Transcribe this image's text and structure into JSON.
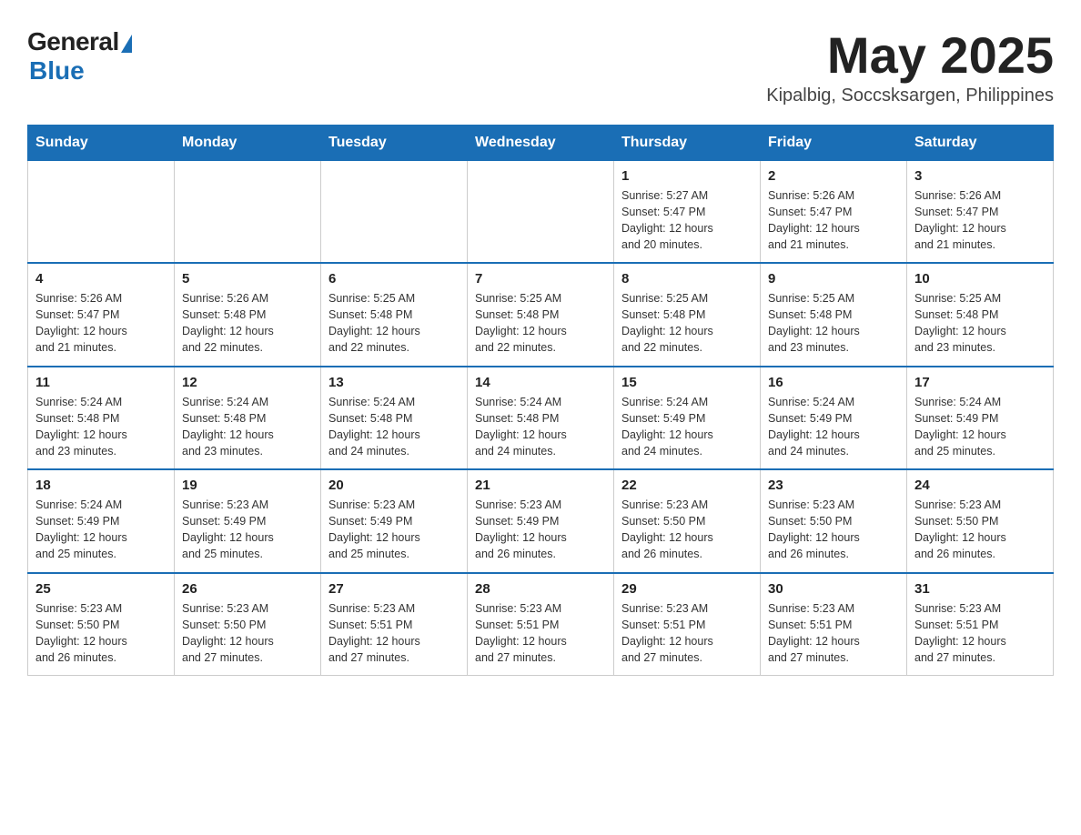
{
  "header": {
    "logo_general": "General",
    "logo_blue": "Blue",
    "month_title": "May 2025",
    "location": "Kipalbig, Soccsksargen, Philippines"
  },
  "weekdays": [
    "Sunday",
    "Monday",
    "Tuesday",
    "Wednesday",
    "Thursday",
    "Friday",
    "Saturday"
  ],
  "weeks": [
    [
      {
        "day": "",
        "info": ""
      },
      {
        "day": "",
        "info": ""
      },
      {
        "day": "",
        "info": ""
      },
      {
        "day": "",
        "info": ""
      },
      {
        "day": "1",
        "info": "Sunrise: 5:27 AM\nSunset: 5:47 PM\nDaylight: 12 hours\nand 20 minutes."
      },
      {
        "day": "2",
        "info": "Sunrise: 5:26 AM\nSunset: 5:47 PM\nDaylight: 12 hours\nand 21 minutes."
      },
      {
        "day": "3",
        "info": "Sunrise: 5:26 AM\nSunset: 5:47 PM\nDaylight: 12 hours\nand 21 minutes."
      }
    ],
    [
      {
        "day": "4",
        "info": "Sunrise: 5:26 AM\nSunset: 5:47 PM\nDaylight: 12 hours\nand 21 minutes."
      },
      {
        "day": "5",
        "info": "Sunrise: 5:26 AM\nSunset: 5:48 PM\nDaylight: 12 hours\nand 22 minutes."
      },
      {
        "day": "6",
        "info": "Sunrise: 5:25 AM\nSunset: 5:48 PM\nDaylight: 12 hours\nand 22 minutes."
      },
      {
        "day": "7",
        "info": "Sunrise: 5:25 AM\nSunset: 5:48 PM\nDaylight: 12 hours\nand 22 minutes."
      },
      {
        "day": "8",
        "info": "Sunrise: 5:25 AM\nSunset: 5:48 PM\nDaylight: 12 hours\nand 22 minutes."
      },
      {
        "day": "9",
        "info": "Sunrise: 5:25 AM\nSunset: 5:48 PM\nDaylight: 12 hours\nand 23 minutes."
      },
      {
        "day": "10",
        "info": "Sunrise: 5:25 AM\nSunset: 5:48 PM\nDaylight: 12 hours\nand 23 minutes."
      }
    ],
    [
      {
        "day": "11",
        "info": "Sunrise: 5:24 AM\nSunset: 5:48 PM\nDaylight: 12 hours\nand 23 minutes."
      },
      {
        "day": "12",
        "info": "Sunrise: 5:24 AM\nSunset: 5:48 PM\nDaylight: 12 hours\nand 23 minutes."
      },
      {
        "day": "13",
        "info": "Sunrise: 5:24 AM\nSunset: 5:48 PM\nDaylight: 12 hours\nand 24 minutes."
      },
      {
        "day": "14",
        "info": "Sunrise: 5:24 AM\nSunset: 5:48 PM\nDaylight: 12 hours\nand 24 minutes."
      },
      {
        "day": "15",
        "info": "Sunrise: 5:24 AM\nSunset: 5:49 PM\nDaylight: 12 hours\nand 24 minutes."
      },
      {
        "day": "16",
        "info": "Sunrise: 5:24 AM\nSunset: 5:49 PM\nDaylight: 12 hours\nand 24 minutes."
      },
      {
        "day": "17",
        "info": "Sunrise: 5:24 AM\nSunset: 5:49 PM\nDaylight: 12 hours\nand 25 minutes."
      }
    ],
    [
      {
        "day": "18",
        "info": "Sunrise: 5:24 AM\nSunset: 5:49 PM\nDaylight: 12 hours\nand 25 minutes."
      },
      {
        "day": "19",
        "info": "Sunrise: 5:23 AM\nSunset: 5:49 PM\nDaylight: 12 hours\nand 25 minutes."
      },
      {
        "day": "20",
        "info": "Sunrise: 5:23 AM\nSunset: 5:49 PM\nDaylight: 12 hours\nand 25 minutes."
      },
      {
        "day": "21",
        "info": "Sunrise: 5:23 AM\nSunset: 5:49 PM\nDaylight: 12 hours\nand 26 minutes."
      },
      {
        "day": "22",
        "info": "Sunrise: 5:23 AM\nSunset: 5:50 PM\nDaylight: 12 hours\nand 26 minutes."
      },
      {
        "day": "23",
        "info": "Sunrise: 5:23 AM\nSunset: 5:50 PM\nDaylight: 12 hours\nand 26 minutes."
      },
      {
        "day": "24",
        "info": "Sunrise: 5:23 AM\nSunset: 5:50 PM\nDaylight: 12 hours\nand 26 minutes."
      }
    ],
    [
      {
        "day": "25",
        "info": "Sunrise: 5:23 AM\nSunset: 5:50 PM\nDaylight: 12 hours\nand 26 minutes."
      },
      {
        "day": "26",
        "info": "Sunrise: 5:23 AM\nSunset: 5:50 PM\nDaylight: 12 hours\nand 27 minutes."
      },
      {
        "day": "27",
        "info": "Sunrise: 5:23 AM\nSunset: 5:51 PM\nDaylight: 12 hours\nand 27 minutes."
      },
      {
        "day": "28",
        "info": "Sunrise: 5:23 AM\nSunset: 5:51 PM\nDaylight: 12 hours\nand 27 minutes."
      },
      {
        "day": "29",
        "info": "Sunrise: 5:23 AM\nSunset: 5:51 PM\nDaylight: 12 hours\nand 27 minutes."
      },
      {
        "day": "30",
        "info": "Sunrise: 5:23 AM\nSunset: 5:51 PM\nDaylight: 12 hours\nand 27 minutes."
      },
      {
        "day": "31",
        "info": "Sunrise: 5:23 AM\nSunset: 5:51 PM\nDaylight: 12 hours\nand 27 minutes."
      }
    ]
  ]
}
